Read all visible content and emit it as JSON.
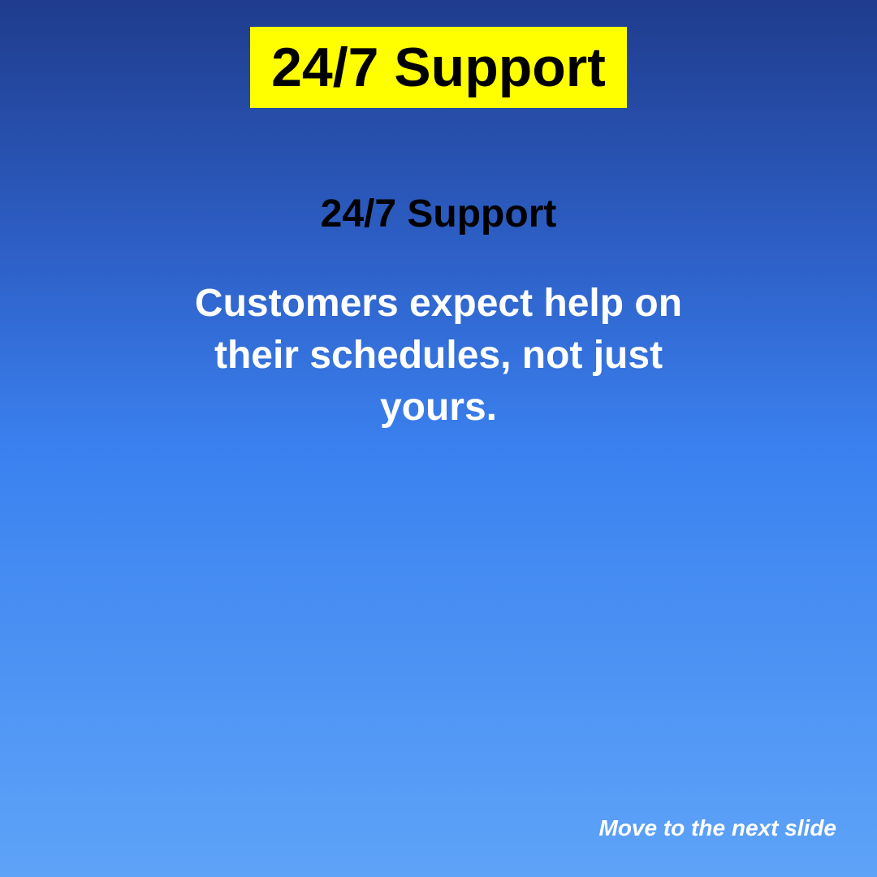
{
  "slide": {
    "banner_title": "24/7 Support",
    "heading": "24/7 Support",
    "body": "Customers expect help on their schedules, not just yours.",
    "next_label": "Move to the next slide"
  },
  "colors": {
    "banner_background": "#ffff00",
    "heading_text": "#000000",
    "body_text": "#ffffff",
    "background_top": "#1f3c8d",
    "background_bottom": "#5ea3f8"
  }
}
